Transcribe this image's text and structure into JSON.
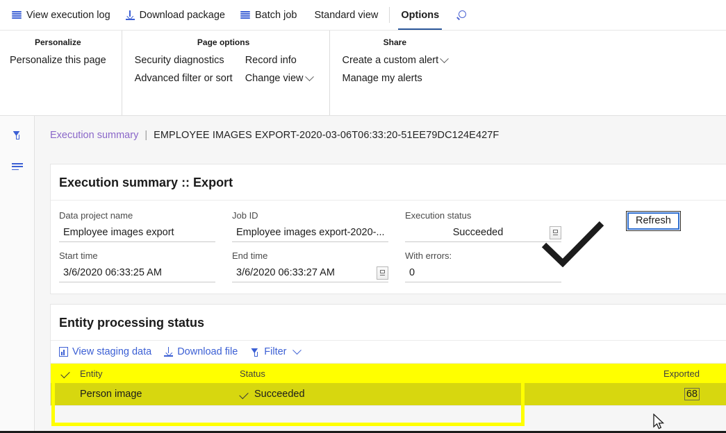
{
  "toolbar": {
    "items": [
      {
        "label": "View execution log",
        "icon": "list-icon"
      },
      {
        "label": "Download package",
        "icon": "download-icon"
      },
      {
        "label": "Batch job",
        "icon": "list-icon"
      }
    ],
    "tabs": [
      {
        "label": "Standard view",
        "active": false
      },
      {
        "label": "Options",
        "active": true
      }
    ],
    "search_icon": "search-icon"
  },
  "ribbon": {
    "groups": [
      {
        "title": "Personalize",
        "columns": [
          {
            "links": [
              {
                "label": "Personalize this page",
                "chevron": false
              }
            ]
          }
        ]
      },
      {
        "title": "Page options",
        "columns": [
          {
            "links": [
              {
                "label": "Security diagnostics",
                "chevron": false
              },
              {
                "label": "Advanced filter or sort",
                "chevron": false
              }
            ]
          },
          {
            "links": [
              {
                "label": "Record info",
                "chevron": false
              },
              {
                "label": "Change view",
                "chevron": true
              }
            ]
          }
        ]
      },
      {
        "title": "Share",
        "columns": [
          {
            "links": [
              {
                "label": "Create a custom alert",
                "chevron": true
              },
              {
                "label": "Manage my alerts",
                "chevron": false
              }
            ]
          }
        ]
      }
    ]
  },
  "rail": {
    "filter_icon": "filter-funnel-icon",
    "lines_icon": "show-list-icon"
  },
  "breadcrumb": {
    "link": "Execution summary",
    "separator": "|",
    "current": "EMPLOYEE IMAGES EXPORT-2020-03-06T06:33:20-51EE79DC124E427F"
  },
  "summary_card": {
    "title": "Execution summary :: Export",
    "fields": [
      {
        "label": "Data project name",
        "value": "Employee images export",
        "button": null,
        "align": "left"
      },
      {
        "label": "Job ID",
        "value": "Employee images export-2020-...",
        "button": null,
        "align": "left"
      },
      {
        "label": "Execution status",
        "value": "Succeeded",
        "button": "lookup-icon",
        "align": "center"
      },
      {
        "label": "Start time",
        "value": "3/6/2020 06:33:25 AM",
        "button": null,
        "align": "left"
      },
      {
        "label": "End time",
        "value": "3/6/2020 06:33:27 AM",
        "button": "calendar-icon",
        "align": "left"
      },
      {
        "label": "With errors:",
        "value": "0",
        "button": null,
        "align": "left"
      }
    ],
    "refresh_label": "Refresh",
    "status_glyph": "check-mark-icon"
  },
  "entity_card": {
    "title": "Entity processing status",
    "toolbar": [
      {
        "label": "View staging data",
        "icon": "staging-data-icon",
        "chevron": false
      },
      {
        "label": "Download file",
        "icon": "download-icon",
        "chevron": false
      },
      {
        "label": "Filter",
        "icon": "filter-funnel-icon",
        "chevron": true
      }
    ],
    "columns": [
      "Entity",
      "Status",
      "Exported"
    ],
    "rows": [
      {
        "entity": "Person image",
        "status": "Succeeded",
        "exported": "68"
      }
    ]
  },
  "colors": {
    "accent_blue": "#3b5fd4",
    "tab_underline": "#2b579a",
    "highlight_yellow": "#ffff00",
    "row_yellow": "#d7d70f",
    "breadcrumb_link": "#8a67c9"
  }
}
